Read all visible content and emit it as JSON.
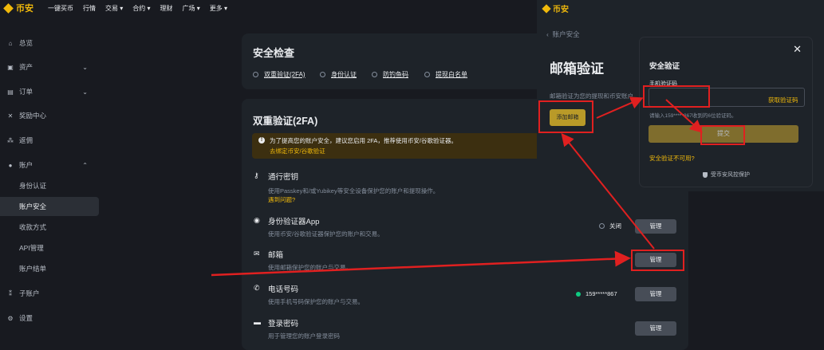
{
  "topnav": {
    "logo": "币安",
    "items": [
      "一键买币",
      "行情",
      "交易 ▾",
      "合约 ▾",
      "理财",
      "广场 ▾",
      "更多 ▾"
    ]
  },
  "sidebar": {
    "items": [
      {
        "label": "总览",
        "icon": "home-icon"
      },
      {
        "label": "资产",
        "icon": "wallet-icon"
      },
      {
        "label": "订单",
        "icon": "orders-icon"
      },
      {
        "label": "奖励中心",
        "icon": "ticket-icon"
      },
      {
        "label": "返佣",
        "icon": "referral-icon"
      },
      {
        "label": "账户",
        "icon": "user-icon"
      },
      {
        "label": "身份认证"
      },
      {
        "label": "账户安全"
      },
      {
        "label": "收款方式"
      },
      {
        "label": "API管理"
      },
      {
        "label": "账户结单"
      },
      {
        "label": "子账户",
        "icon": "sub-account-icon"
      },
      {
        "label": "设置",
        "icon": "gear-icon"
      }
    ]
  },
  "security_check": {
    "title": "安全检查",
    "items": [
      "双重验证(2FA)",
      "身份认证",
      "防钓鱼码",
      "提现白名单"
    ]
  },
  "twofa": {
    "title": "双重验证(2FA)",
    "notice": "为了提高您的账户安全，建议您启用 2FA，推荐使用币安/谷歌验证器。",
    "notice_link": "去绑定币安/谷歌验证",
    "rows": [
      {
        "title": "通行密钥",
        "desc": "使用Passkey和/或Yubikey等安全设备保护您的账户和提现操作。",
        "link": "遇到问题?"
      },
      {
        "title": "身份验证器App",
        "desc": "使用币安/谷歌验证器保护您的账户和交易。",
        "status": "关闭",
        "button": "管理"
      },
      {
        "title": "邮箱",
        "desc": "使用邮箱保护您的账户与交易。",
        "button": "管理"
      },
      {
        "title": "电话号码",
        "desc": "使用手机号码保护您的账户与交易。",
        "status": "159*****867",
        "button": "管理"
      },
      {
        "title": "登录密码",
        "desc": "用于管理您的账户登录密码",
        "button": "管理"
      }
    ]
  },
  "email_page": {
    "logo": "币安",
    "back": "账户安全",
    "title": "邮箱验证",
    "desc": "邮箱验证为您的提现和币安账户",
    "add_button": "添加邮箱"
  },
  "modal": {
    "title": "安全验证",
    "field_label": "手机验证码",
    "get_code": "获取验证码",
    "hint": "请输入159*****867收到的6位验证码。",
    "submit": "提交",
    "unavailable": "安全验证不可用?",
    "protection": "受币安风控保护"
  },
  "colors": {
    "background": "#181a20",
    "card": "#1e2329",
    "accent": "#f0b90b",
    "annotation": "#e02020",
    "success": "#0ecb81"
  }
}
